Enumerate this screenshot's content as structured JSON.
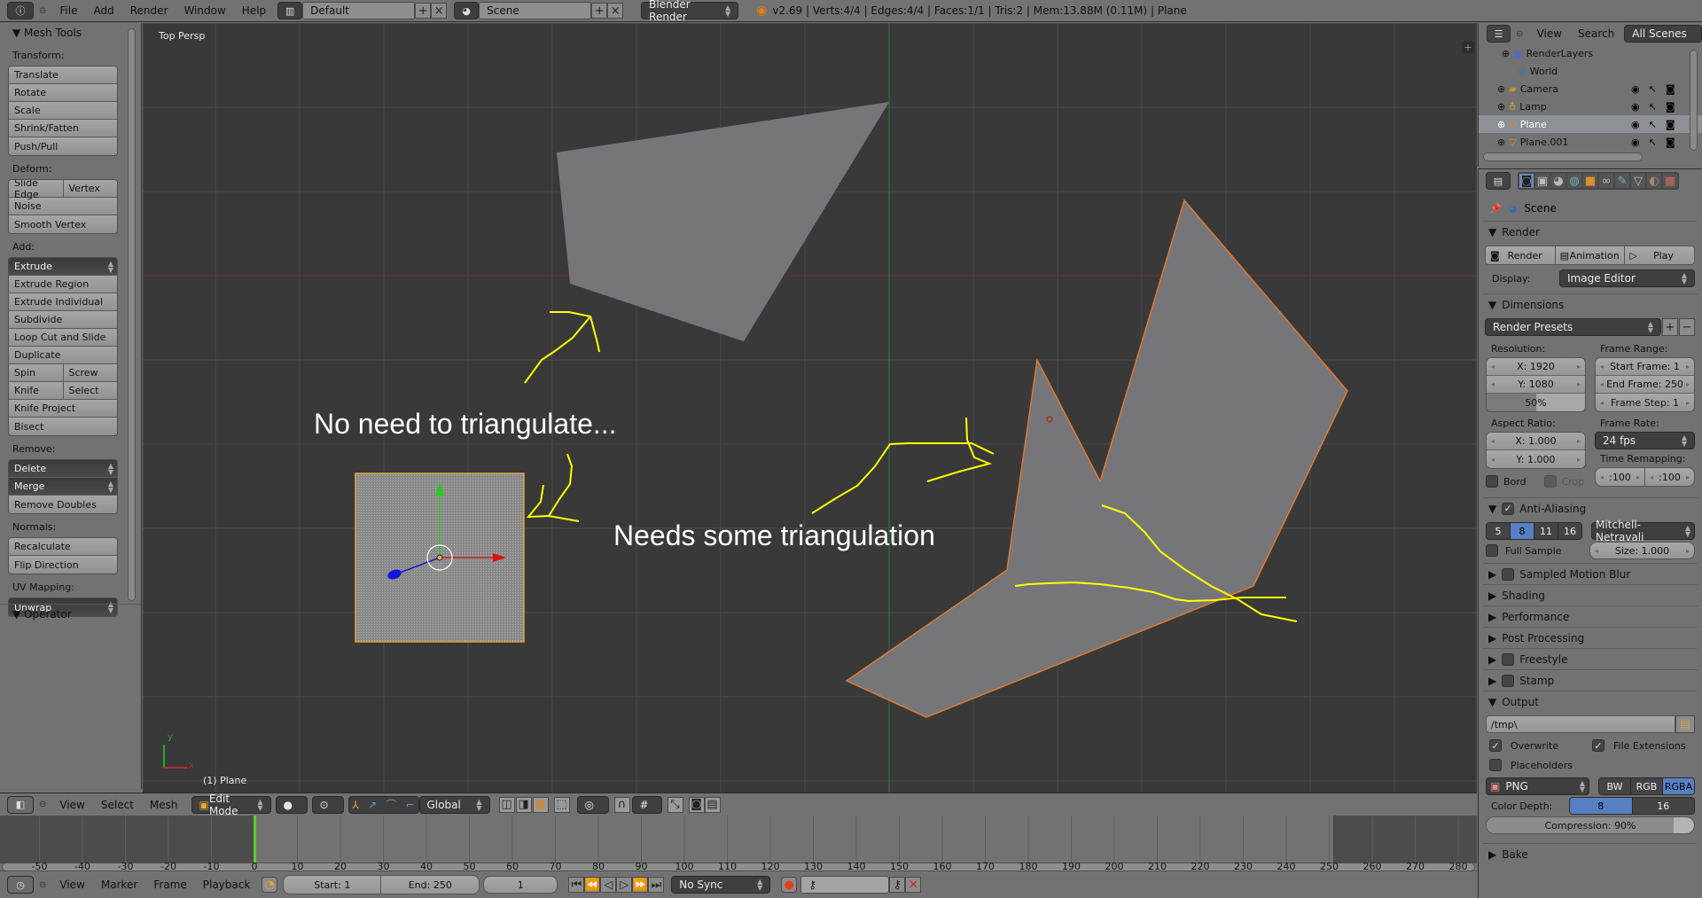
{
  "topbar": {
    "menus": [
      "File",
      "Add",
      "Render",
      "Window",
      "Help"
    ],
    "screen_layout": "Default",
    "scene": "Scene",
    "render_engine": "Blender Render",
    "stats": "v2.69 | Verts:4/4 | Edges:4/4 | Faces:1/1 | Tris:2 | Mem:13.88M (0.11M) | Plane"
  },
  "toolpanel": {
    "title": "Mesh Tools",
    "transform_label": "Transform:",
    "transform": [
      "Translate",
      "Rotate",
      "Scale",
      "Shrink/Fatten",
      "Push/Pull"
    ],
    "deform_label": "Deform:",
    "deform_split": [
      "Slide Edge",
      "Vertex"
    ],
    "deform": [
      "Noise",
      "Smooth Vertex"
    ],
    "add_label": "Add:",
    "extrude": "Extrude",
    "add": [
      "Extrude Region",
      "Extrude Individual",
      "Subdivide",
      "Loop Cut and Slide",
      "Duplicate"
    ],
    "add_split1": [
      "Spin",
      "Screw"
    ],
    "add_split2": [
      "Knife",
      "Select"
    ],
    "add2": [
      "Knife Project",
      "Bisect"
    ],
    "remove_label": "Remove:",
    "delete": "Delete",
    "merge": "Merge",
    "remove_doubles": "Remove Doubles",
    "normals_label": "Normals:",
    "normals": [
      "Recalculate",
      "Flip Direction"
    ],
    "uv_label": "UV Mapping:",
    "unwrap": "Unwrap",
    "operator": "Operator"
  },
  "viewport": {
    "view_name": "Top Persp",
    "object_label": "(1) Plane",
    "annotation1": "No need to triangulate...",
    "annotation2": "Needs some triangulation",
    "axis_y": "y",
    "axis_x": "x"
  },
  "viewport_header": {
    "menus": [
      "View",
      "Select",
      "Mesh"
    ],
    "mode": "Edit Mode",
    "orientation": "Global"
  },
  "timeline": {
    "ticks": [
      "-50",
      "-40",
      "-30",
      "-20",
      "-10",
      "0",
      "10",
      "20",
      "30",
      "40",
      "50",
      "60",
      "70",
      "80",
      "90",
      "100",
      "110",
      "120",
      "130",
      "140",
      "150",
      "160",
      "170",
      "180",
      "190",
      "200",
      "210",
      "220",
      "230",
      "240",
      "250",
      "260",
      "270",
      "280"
    ],
    "menus": [
      "View",
      "Marker",
      "Frame",
      "Playback"
    ],
    "start": "Start: 1",
    "end": "End: 250",
    "current": "1",
    "sync": "No Sync"
  },
  "outliner": {
    "menus": [
      "View",
      "Search"
    ],
    "filter": "All Scenes",
    "items": [
      {
        "label": "RenderLayers",
        "selected": false
      },
      {
        "label": "World",
        "selected": false
      },
      {
        "label": "Camera",
        "selected": false
      },
      {
        "label": "Lamp",
        "selected": false
      },
      {
        "label": "Plane",
        "selected": true
      },
      {
        "label": "Plane.001",
        "selected": false
      }
    ]
  },
  "properties": {
    "context": "Scene",
    "render": {
      "title": "Render",
      "buttons": [
        "Render",
        "Animation",
        "Play"
      ],
      "display_label": "Display:",
      "display_value": "Image Editor"
    },
    "dimensions": {
      "title": "Dimensions",
      "presets": "Render Presets",
      "resolution_label": "Resolution:",
      "res_x": "X: 1920",
      "res_y": "Y: 1080",
      "res_pct": "50%",
      "res_pct_value": 0.5,
      "frame_range_label": "Frame Range:",
      "start_frame": "Start Frame: 1",
      "end_frame": "End Frame: 250",
      "frame_step": "Frame Step: 1",
      "aspect_label": "Aspect Ratio:",
      "aspect_x": "X: 1.000",
      "aspect_y": "Y: 1.000",
      "frame_rate_label": "Frame Rate:",
      "frame_rate": "24 fps",
      "time_remap_label": "Time Remapping:",
      "remap_old": ":100",
      "remap_new": ":100",
      "bord": "Bord",
      "crop": "Crop"
    },
    "anti_aliasing": {
      "title": "Anti-Aliasing",
      "samples": [
        "5",
        "8",
        "11",
        "16"
      ],
      "selected_sample": "8",
      "filter": "Mitchell-Netravali",
      "full_sample": "Full Sample",
      "size": "Size: 1.000"
    },
    "collapsed_sections": [
      "Sampled Motion Blur",
      "Shading",
      "Performance",
      "Post Processing",
      "Freestyle",
      "Stamp"
    ],
    "output": {
      "title": "Output",
      "path": "/tmp\\",
      "overwrite": "Overwrite",
      "file_extensions": "File Extensions",
      "placeholders": "Placeholders",
      "format": "PNG",
      "color_modes": [
        "BW",
        "RGB",
        "RGBA"
      ],
      "selected_color_mode": "RGBA",
      "color_depth_label": "Color Depth:",
      "depths": [
        "8",
        "16"
      ],
      "selected_depth": "8",
      "compression": "Compression: 90%",
      "compression_value": 0.9
    },
    "bake": "Bake"
  },
  "colors": {
    "viewport_bg": "#393939",
    "mesh_face": "#76767a",
    "edge_selected": "#e07a2f",
    "annotation": "#ffff00",
    "x_axis": "#8a2a2a",
    "y_axis": "#2c7a2c",
    "selection_blue": "#5680c2"
  }
}
